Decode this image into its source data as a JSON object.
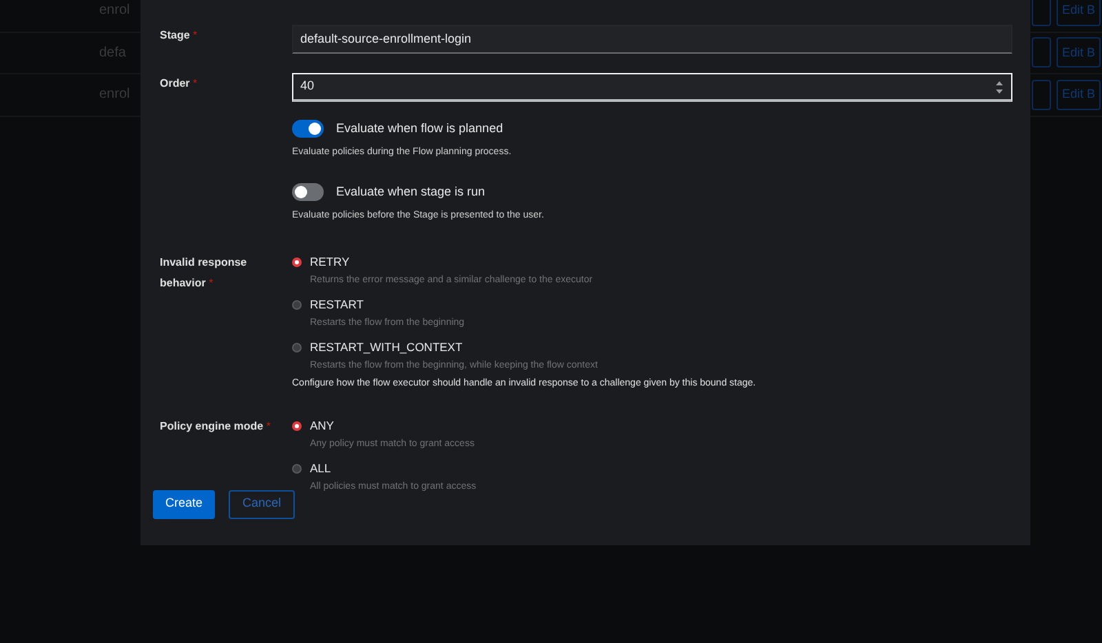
{
  "background_table": {
    "rows": [
      {
        "name": "enrol",
        "actions": [
          "Edit B"
        ]
      },
      {
        "name": "defa",
        "actions": [
          "Edit B"
        ]
      },
      {
        "name": "enrol",
        "actions": [
          "Edit B"
        ]
      }
    ]
  },
  "modal": {
    "fields": [
      {
        "kind": "text",
        "label": "Stage",
        "required_mark": "*",
        "value": "default-source-enrollment-login",
        "focused": false
      },
      {
        "kind": "number",
        "label": "Order",
        "required_mark": "*",
        "value": "40",
        "focused": true
      }
    ],
    "toggles": [
      {
        "label": "Evaluate when flow is planned",
        "description": "Evaluate policies during the Flow planning process.",
        "on": true
      },
      {
        "label": "Evaluate when stage is run",
        "description": "Evaluate policies before the Stage is presented to the user.",
        "on": false
      }
    ],
    "radio_groups": [
      {
        "label": "Invalid response behavior",
        "required_mark": "*",
        "options": [
          {
            "label": "RETRY",
            "description": "Returns the error message and a similar challenge to the executor",
            "selected": true
          },
          {
            "label": "RESTART",
            "description": "Restarts the flow from the beginning",
            "selected": false
          },
          {
            "label": "RESTART_WITH_CONTEXT",
            "description": "Restarts the flow from the beginning, while keeping the flow context",
            "selected": false
          }
        ],
        "help": "Configure how the flow executor should handle an invalid response to a challenge given by this bound stage."
      },
      {
        "label": "Policy engine mode",
        "required_mark": "*",
        "options": [
          {
            "label": "ANY",
            "description": "Any policy must match to grant access",
            "selected": true
          },
          {
            "label": "ALL",
            "description": "All policies must match to grant access",
            "selected": false
          }
        ]
      }
    ],
    "buttons": [
      {
        "label": "Create",
        "kind": "primary"
      },
      {
        "label": "Cancel",
        "kind": "secondary"
      }
    ]
  }
}
